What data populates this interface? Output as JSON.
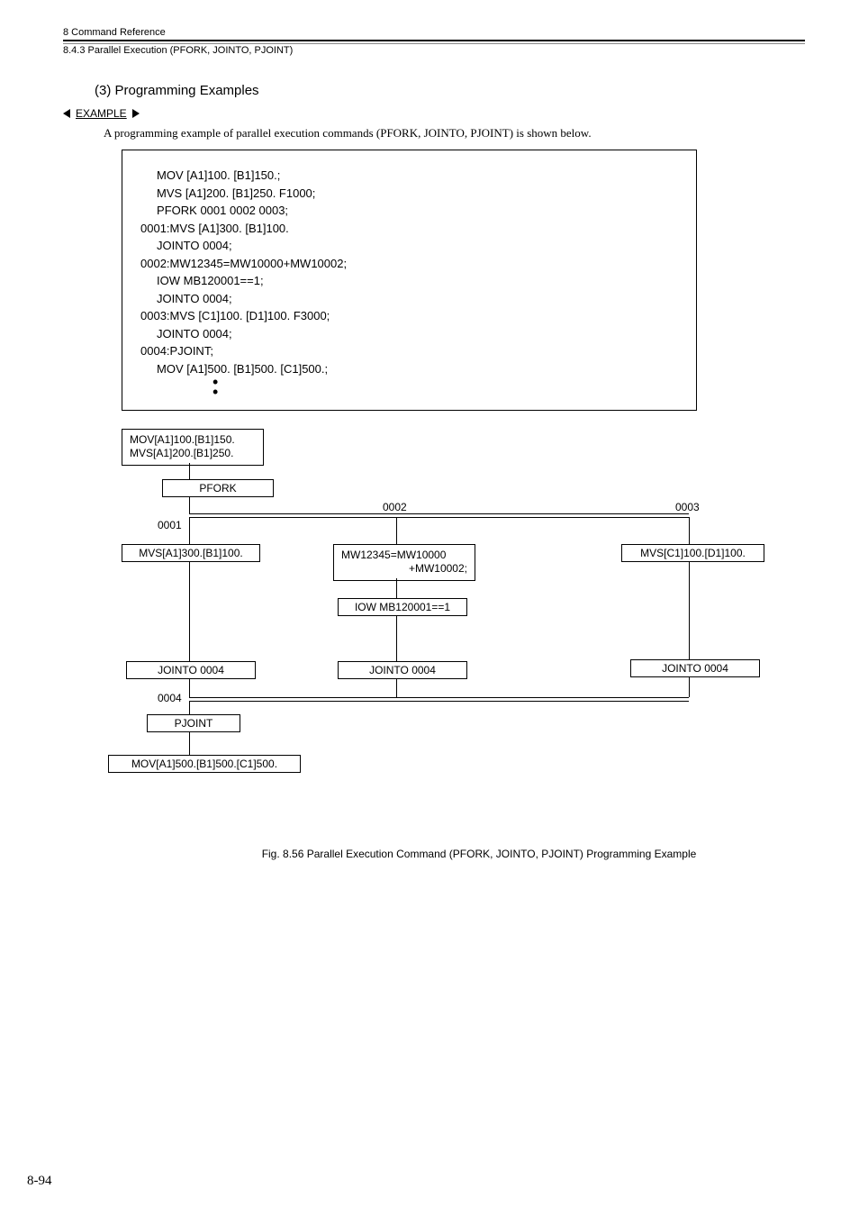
{
  "header": {
    "chapter": "8  Command Reference",
    "section": "8.4.3  Parallel Execution (PFORK, JOINTO, PJOINT)"
  },
  "title": "(3) Programming Examples",
  "exampleLabel": "EXAMPLE",
  "bodyText": "A programming example of parallel execution commands (PFORK, JOINTO, PJOINT) is shown below.",
  "code": {
    "l1": "     MOV [A1]100. [B1]150.;",
    "l2": "     MVS [A1]200. [B1]250. F1000;",
    "l3": "     PFORK 0001 0002 0003;",
    "l4": "0001:MVS [A1]300. [B1]100.",
    "l5": "     JOINTO 0004;",
    "l6": "0002:MW12345=MW10000+MW10002;",
    "l7": "     IOW MB120001==1;",
    "l8": "     JOINTO 0004;",
    "l9": "0003:MVS [C1]100. [D1]100. F3000;",
    "l10": "     JOINTO 0004;",
    "l11": "0004:PJOINT;",
    "l12": "     MOV [A1]500. [B1]500. [C1]500.;"
  },
  "diagram": {
    "top1": "MOV[A1]100.[B1]150.",
    "top2": "MVS[A1]200.[B1]250.",
    "pfork": "PFORK",
    "n1": "0001",
    "n2": "0002",
    "n3": "0003",
    "n4": "0004",
    "b1": "MVS[A1]300.[B1]100.",
    "b2a": "MW12345=MW10000",
    "b2b": "+MW10002;",
    "iow": "IOW MB120001==1",
    "b3": "MVS[C1]100.[D1]100.",
    "jointo": "JOINTO  0004",
    "jointo2": "JOINTO 0004",
    "jointo3": "JOINTO 0004",
    "pjoint": "PJOINT",
    "bottom": "MOV[A1]500.[B1]500.[C1]500."
  },
  "figcaption": "Fig. 8.56  Parallel Execution Command (PFORK, JOINTO, PJOINT) Programming Example",
  "pageNum": "8-94"
}
